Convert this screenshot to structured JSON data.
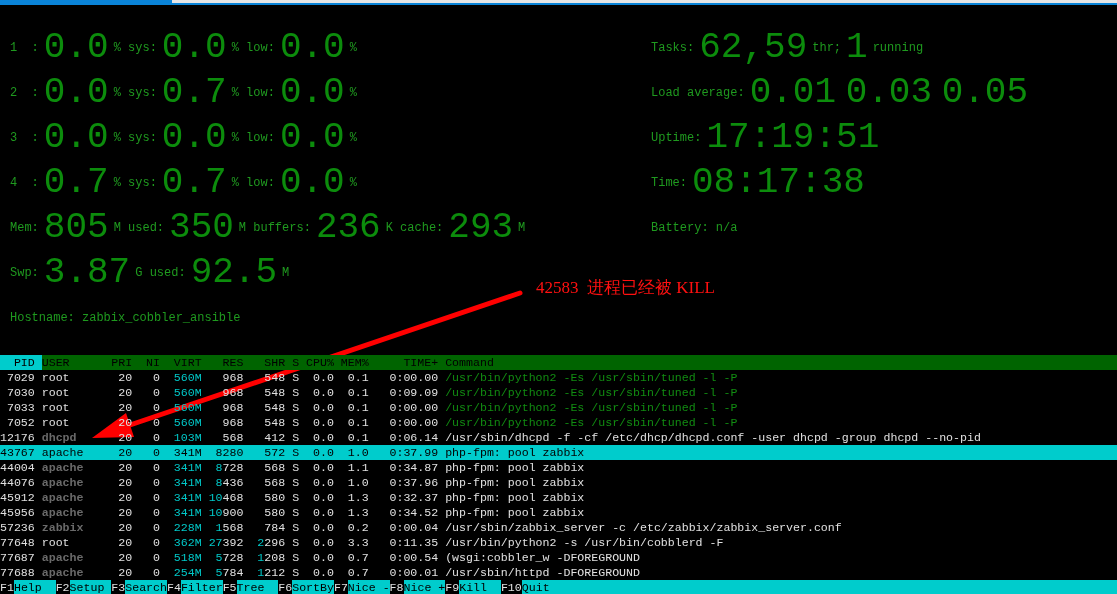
{
  "meters_left": [
    {
      "parts": [
        {
          "kind": "label",
          "text": "1  :"
        },
        {
          "kind": "big",
          "text": "0.0"
        },
        {
          "kind": "label",
          "text": "% sys:"
        },
        {
          "kind": "big",
          "text": "0.0"
        },
        {
          "kind": "label",
          "text": "% low:"
        },
        {
          "kind": "big",
          "text": "0.0"
        },
        {
          "kind": "label",
          "text": "%"
        }
      ]
    },
    {
      "parts": [
        {
          "kind": "label",
          "text": "2  :"
        },
        {
          "kind": "big",
          "text": "0.0"
        },
        {
          "kind": "label",
          "text": "% sys:"
        },
        {
          "kind": "big",
          "text": "0.7"
        },
        {
          "kind": "label",
          "text": "% low:"
        },
        {
          "kind": "big",
          "text": "0.0"
        },
        {
          "kind": "label",
          "text": "%"
        }
      ]
    },
    {
      "parts": [
        {
          "kind": "label",
          "text": "3  :"
        },
        {
          "kind": "big",
          "text": "0.0"
        },
        {
          "kind": "label",
          "text": "% sys:"
        },
        {
          "kind": "big",
          "text": "0.0"
        },
        {
          "kind": "label",
          "text": "% low:"
        },
        {
          "kind": "big",
          "text": "0.0"
        },
        {
          "kind": "label",
          "text": "%"
        }
      ]
    },
    {
      "parts": [
        {
          "kind": "label",
          "text": "4  :"
        },
        {
          "kind": "big",
          "text": "0.7"
        },
        {
          "kind": "label",
          "text": "% sys:"
        },
        {
          "kind": "big",
          "text": "0.7"
        },
        {
          "kind": "label",
          "text": "% low:"
        },
        {
          "kind": "big",
          "text": "0.0"
        },
        {
          "kind": "label",
          "text": "%"
        }
      ]
    },
    {
      "parts": [
        {
          "kind": "label",
          "text": "Mem:"
        },
        {
          "kind": "big",
          "text": "805"
        },
        {
          "kind": "label",
          "text": "M used:"
        },
        {
          "kind": "big",
          "text": "350"
        },
        {
          "kind": "label",
          "text": "M buffers:"
        },
        {
          "kind": "big",
          "text": "236"
        },
        {
          "kind": "label",
          "text": "K cache:"
        },
        {
          "kind": "big",
          "text": "293"
        },
        {
          "kind": "label",
          "text": "M"
        }
      ]
    },
    {
      "parts": [
        {
          "kind": "label",
          "text": "Swp:"
        },
        {
          "kind": "big",
          "text": "3.87"
        },
        {
          "kind": "label",
          "text": "G used:"
        },
        {
          "kind": "big",
          "text": "92.5"
        },
        {
          "kind": "label",
          "text": "M"
        }
      ]
    },
    {
      "parts": [
        {
          "kind": "label",
          "text": "Hostname: zabbix_cobbler_ansible"
        }
      ]
    }
  ],
  "meters_right": [
    {
      "parts": [
        {
          "kind": "label",
          "text": "Tasks:"
        },
        {
          "kind": "big",
          "text": "62,59"
        },
        {
          "kind": "label",
          "text": "thr;"
        },
        {
          "kind": "big",
          "text": "1"
        },
        {
          "kind": "label",
          "text": "running"
        }
      ]
    },
    {
      "parts": [
        {
          "kind": "label",
          "text": "Load average:"
        },
        {
          "kind": "big",
          "text": "0.01 0.03 0.05"
        }
      ]
    },
    {
      "parts": [
        {
          "kind": "label",
          "text": "Uptime:"
        },
        {
          "kind": "big",
          "text": "17:19:51"
        }
      ]
    },
    {
      "parts": [
        {
          "kind": "label",
          "text": "Time:"
        },
        {
          "kind": "big",
          "text": "08:17:38"
        }
      ]
    },
    {
      "parts": [
        {
          "kind": "label",
          "text": "Battery: n/a"
        }
      ]
    }
  ],
  "annotation": {
    "text": "42583  进程已经被 KILL"
  },
  "table": {
    "columns": [
      {
        "label": "PID",
        "sort": true
      },
      {
        "label": "USER",
        "sort": false
      },
      {
        "label": "PRI",
        "sort": false
      },
      {
        "label": "NI",
        "sort": false
      },
      {
        "label": "VIRT",
        "sort": false
      },
      {
        "label": "RES",
        "sort": false
      },
      {
        "label": "SHR",
        "sort": false
      },
      {
        "label": "S",
        "sort": false
      },
      {
        "label": "CPU%",
        "sort": false
      },
      {
        "label": "MEM%",
        "sort": false
      },
      {
        "label": "TIME+",
        "sort": false
      },
      {
        "label": "Command",
        "sort": false
      }
    ],
    "rows": [
      {
        "selected": false,
        "dim_user": false,
        "thread": true,
        "cells": [
          "7029",
          "root",
          "20",
          "0",
          "560M",
          "968",
          "548",
          "S",
          "0.0",
          "0.1",
          "0:00.00",
          "/usr/bin/python2 -Es /usr/sbin/tuned -l -P"
        ]
      },
      {
        "selected": false,
        "dim_user": false,
        "thread": true,
        "cells": [
          "7030",
          "root",
          "20",
          "0",
          "560M",
          "968",
          "548",
          "S",
          "0.0",
          "0.1",
          "0:09.09",
          "/usr/bin/python2 -Es /usr/sbin/tuned -l -P"
        ]
      },
      {
        "selected": false,
        "dim_user": false,
        "thread": true,
        "cells": [
          "7033",
          "root",
          "20",
          "0",
          "560M",
          "968",
          "548",
          "S",
          "0.0",
          "0.1",
          "0:00.00",
          "/usr/bin/python2 -Es /usr/sbin/tuned -l -P"
        ]
      },
      {
        "selected": false,
        "dim_user": false,
        "thread": true,
        "cells": [
          "7052",
          "root",
          "20",
          "0",
          "560M",
          "968",
          "548",
          "S",
          "0.0",
          "0.1",
          "0:00.00",
          "/usr/bin/python2 -Es /usr/sbin/tuned -l -P"
        ]
      },
      {
        "selected": false,
        "dim_user": true,
        "thread": false,
        "cells": [
          "12176",
          "dhcpd",
          "20",
          "0",
          "103M",
          "568",
          "412",
          "S",
          "0.0",
          "0.1",
          "0:06.14",
          "/usr/sbin/dhcpd -f -cf /etc/dhcp/dhcpd.conf -user dhcpd -group dhcpd --no-pid"
        ]
      },
      {
        "selected": true,
        "dim_user": false,
        "thread": false,
        "cells": [
          "43767",
          "apache",
          "20",
          "0",
          "341M",
          "8280",
          "572",
          "S",
          "0.0",
          "1.0",
          "0:37.99",
          "php-fpm: pool zabbix"
        ]
      },
      {
        "selected": false,
        "dim_user": true,
        "thread": false,
        "cells": [
          "44004",
          "apache",
          "20",
          "0",
          "341M",
          "8728",
          "568",
          "S",
          "0.0",
          "1.1",
          "0:34.87",
          "php-fpm: pool zabbix"
        ]
      },
      {
        "selected": false,
        "dim_user": true,
        "thread": false,
        "cells": [
          "44076",
          "apache",
          "20",
          "0",
          "341M",
          "8436",
          "568",
          "S",
          "0.0",
          "1.0",
          "0:37.96",
          "php-fpm: pool zabbix"
        ]
      },
      {
        "selected": false,
        "dim_user": true,
        "thread": false,
        "cells": [
          "45912",
          "apache",
          "20",
          "0",
          "341M",
          "10468",
          "580",
          "S",
          "0.0",
          "1.3",
          "0:32.37",
          "php-fpm: pool zabbix"
        ]
      },
      {
        "selected": false,
        "dim_user": true,
        "thread": false,
        "cells": [
          "45956",
          "apache",
          "20",
          "0",
          "341M",
          "10900",
          "580",
          "S",
          "0.0",
          "1.3",
          "0:34.52",
          "php-fpm: pool zabbix"
        ]
      },
      {
        "selected": false,
        "dim_user": true,
        "thread": false,
        "cells": [
          "57236",
          "zabbix",
          "20",
          "0",
          "228M",
          "1568",
          "784",
          "S",
          "0.0",
          "0.2",
          "0:00.04",
          "/usr/sbin/zabbix_server -c /etc/zabbix/zabbix_server.conf"
        ]
      },
      {
        "selected": false,
        "dim_user": false,
        "thread": false,
        "cells": [
          "77648",
          "root",
          "20",
          "0",
          "362M",
          "27392",
          "2296",
          "S",
          "0.0",
          "3.3",
          "0:11.35",
          "/usr/bin/python2 -s /usr/bin/cobblerd -F"
        ]
      },
      {
        "selected": false,
        "dim_user": true,
        "thread": false,
        "cells": [
          "77687",
          "apache",
          "20",
          "0",
          "518M",
          "5728",
          "1208",
          "S",
          "0.0",
          "0.7",
          "0:00.54",
          "(wsgi:cobbler_w -DFOREGROUND"
        ]
      },
      {
        "selected": false,
        "dim_user": true,
        "thread": false,
        "cells": [
          "77688",
          "apache",
          "20",
          "0",
          "254M",
          "5784",
          "1212",
          "S",
          "0.0",
          "0.7",
          "0:00.01",
          "/usr/sbin/httpd -DFOREGROUND"
        ]
      }
    ]
  },
  "function_keys": [
    {
      "key": "F1",
      "label": "Help"
    },
    {
      "key": "F2",
      "label": "Setup"
    },
    {
      "key": "F3",
      "label": "Search"
    },
    {
      "key": "F4",
      "label": "Filter"
    },
    {
      "key": "F5",
      "label": "Tree"
    },
    {
      "key": "F6",
      "label": "SortBy"
    },
    {
      "key": "F7",
      "label": "Nice -"
    },
    {
      "key": "F8",
      "label": "Nice +"
    },
    {
      "key": "F9",
      "label": "Kill"
    },
    {
      "key": "F10",
      "label": "Quit"
    }
  ]
}
